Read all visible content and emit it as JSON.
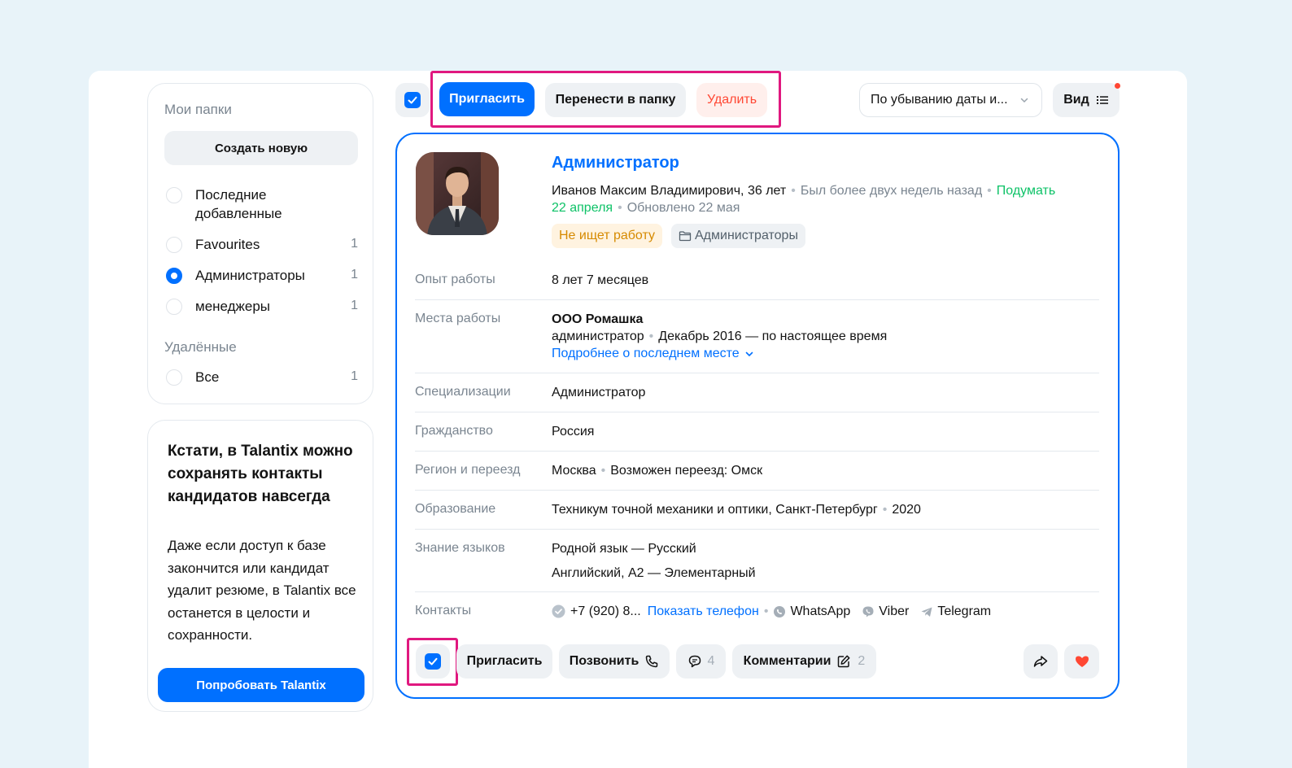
{
  "sidebar": {
    "folders_title": "Мои папки",
    "create_label": "Создать новую",
    "items": [
      {
        "label": "Последние добавленные",
        "count": "",
        "selected": false
      },
      {
        "label": "Favourites",
        "count": "1",
        "selected": false
      },
      {
        "label": "Администраторы",
        "count": "1",
        "selected": true
      },
      {
        "label": "менеджеры",
        "count": "1",
        "selected": false
      }
    ],
    "deleted_title": "Удалённые",
    "deleted_items": [
      {
        "label": "Все",
        "count": "1"
      }
    ]
  },
  "promo": {
    "heading": "Кстати, в Talantix можно сохранять контакты кандидатов навсегда",
    "body": "Даже если доступ к базе закончится или кандидат удалит резюме, в Talantix все останется в целости и сохранности.",
    "button_label": "Попробовать Talantix"
  },
  "toolbar": {
    "invite_label": "Пригласить",
    "move_label": "Перенести в папку",
    "delete_label": "Удалить",
    "sort_value": "По убыванию даты и...",
    "view_label": "Вид"
  },
  "resume": {
    "title": "Администратор",
    "person": "Иванов Максим Владимирович, 36 лет",
    "last_seen": "Был более двух недель назад",
    "think": "Подумать",
    "think_date": "22 апреля",
    "updated": "Обновлено 22 мая",
    "status_tag": "Не ищет работу",
    "folder_tag": "Администраторы",
    "rows": {
      "experience_label": "Опыт работы",
      "experience_value": "8 лет 7 месяцев",
      "jobs_label": "Места работы",
      "company": "ООО Ромашка",
      "position": "администратор",
      "period": "Декабрь 2016 — по настоящее время",
      "more_link": "Подробнее о последнем месте",
      "spec_label": "Специализации",
      "spec_value": "Администратор",
      "citizenship_label": "Гражданство",
      "citizenship_value": "Россия",
      "region_label": "Регион и переезд",
      "region_city": "Москва",
      "relocation": "Возможен переезд: Омск",
      "education_label": "Образование",
      "education_value": "Техникум точной механики и оптики, Санкт-Петербург",
      "education_year": "2020",
      "languages_label": "Знание языков",
      "language_native": "Родной язык — Русский",
      "language_other": "Английский, A2 — Элементарный",
      "contacts_label": "Контакты",
      "phone": "+7 (920) 8...",
      "show_phone": "Показать телефон",
      "whatsapp": "WhatsApp",
      "viber": "Viber",
      "telegram": "Telegram"
    },
    "actions": {
      "invite_label": "Пригласить",
      "call_label": "Позвонить",
      "messages_count": "4",
      "comments_label": "Комментарии",
      "comments_count": "2"
    }
  },
  "colors": {
    "accent": "#0070ff",
    "highlight": "#e0187f",
    "danger": "#ff4733",
    "success": "#0dc267"
  }
}
